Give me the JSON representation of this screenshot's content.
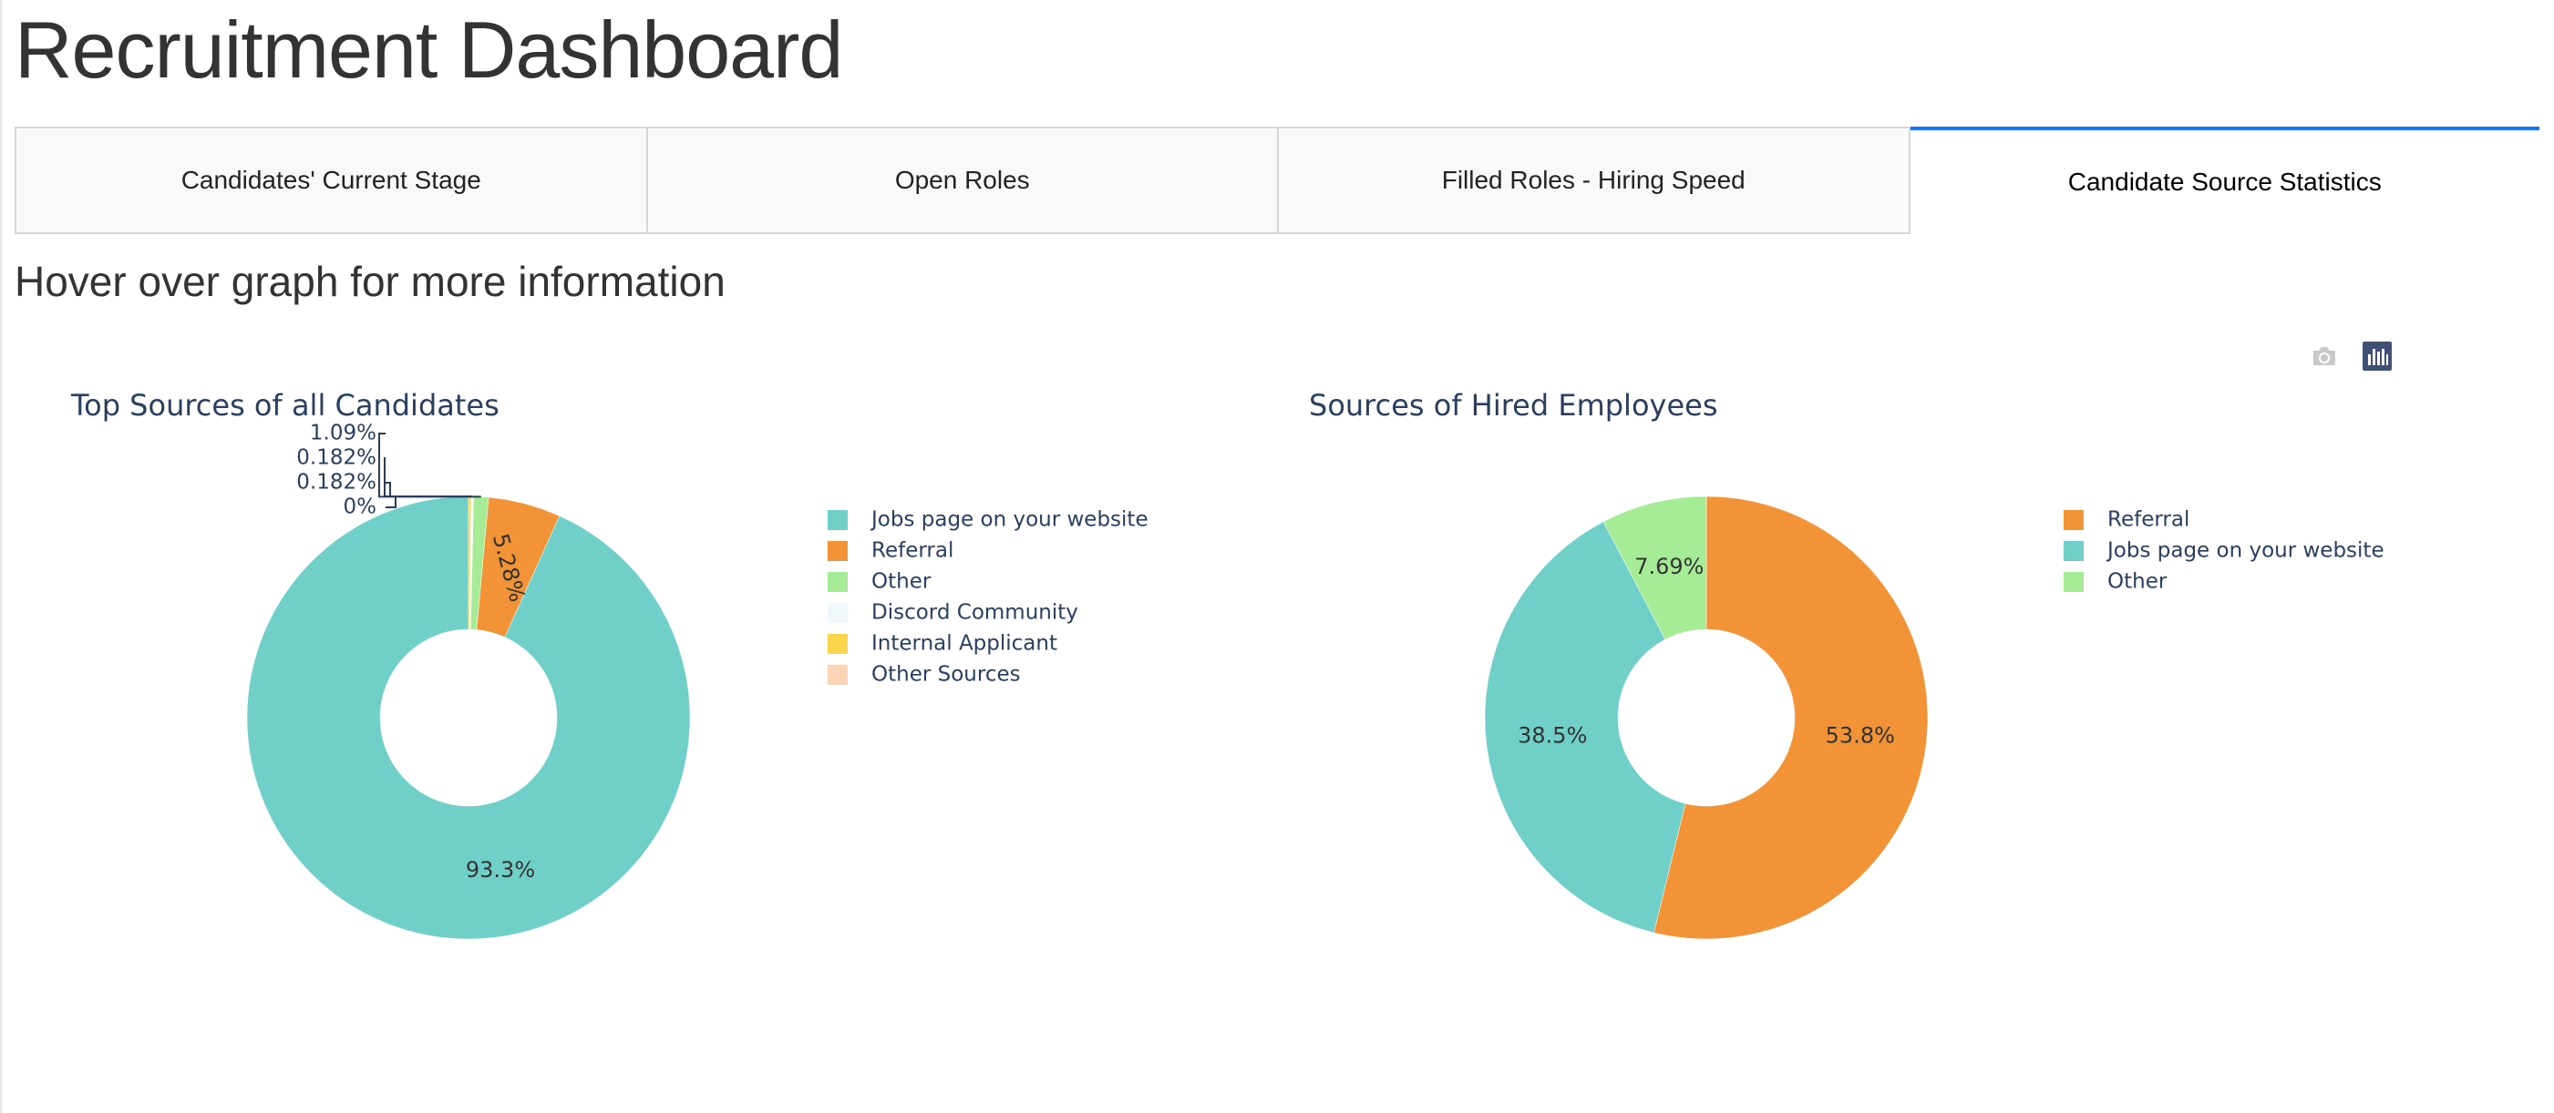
{
  "page": {
    "title": "Recruitment Dashboard",
    "subtitle": "Hover over graph for more information"
  },
  "tabs": [
    {
      "label": "Candidates' Current Stage",
      "active": false
    },
    {
      "label": "Open Roles",
      "active": false
    },
    {
      "label": "Filled Roles - Hiring Speed",
      "active": false
    },
    {
      "label": "Candidate Source Statistics",
      "active": true
    }
  ],
  "modebar": {
    "icons": [
      "camera-icon",
      "plotly-logo-icon"
    ]
  },
  "colors": {
    "Jobs page on your website": "#70d0c9",
    "Referral": "#f29337",
    "Other": "#a6ec97",
    "Discord Community": "#f0f8fc",
    "Internal Applicant": "#fbd54b",
    "Other Sources": "#fad4b4",
    "active_tab_border": "#1975fa"
  },
  "chart_data": [
    {
      "type": "pie",
      "hole": true,
      "title": "Top Sources of all Candidates",
      "legend_position": "right",
      "slices": [
        {
          "label": "Jobs page on your website",
          "value": 93.3,
          "text": "93.3%"
        },
        {
          "label": "Referral",
          "value": 5.28,
          "text": "5.28%"
        },
        {
          "label": "Other",
          "value": 1.09,
          "text": "1.09%"
        },
        {
          "label": "Discord Community",
          "value": 0.182,
          "text": "0.182%"
        },
        {
          "label": "Internal Applicant",
          "value": 0.182,
          "text": "0.182%"
        },
        {
          "label": "Other Sources",
          "value": 0,
          "text": "0%"
        }
      ]
    },
    {
      "type": "pie",
      "hole": true,
      "title": "Sources of Hired Employees",
      "legend_position": "right",
      "slices": [
        {
          "label": "Referral",
          "value": 53.8,
          "text": "53.8%"
        },
        {
          "label": "Jobs page on your website",
          "value": 38.5,
          "text": "38.5%"
        },
        {
          "label": "Other",
          "value": 7.69,
          "text": "7.69%"
        }
      ]
    }
  ]
}
